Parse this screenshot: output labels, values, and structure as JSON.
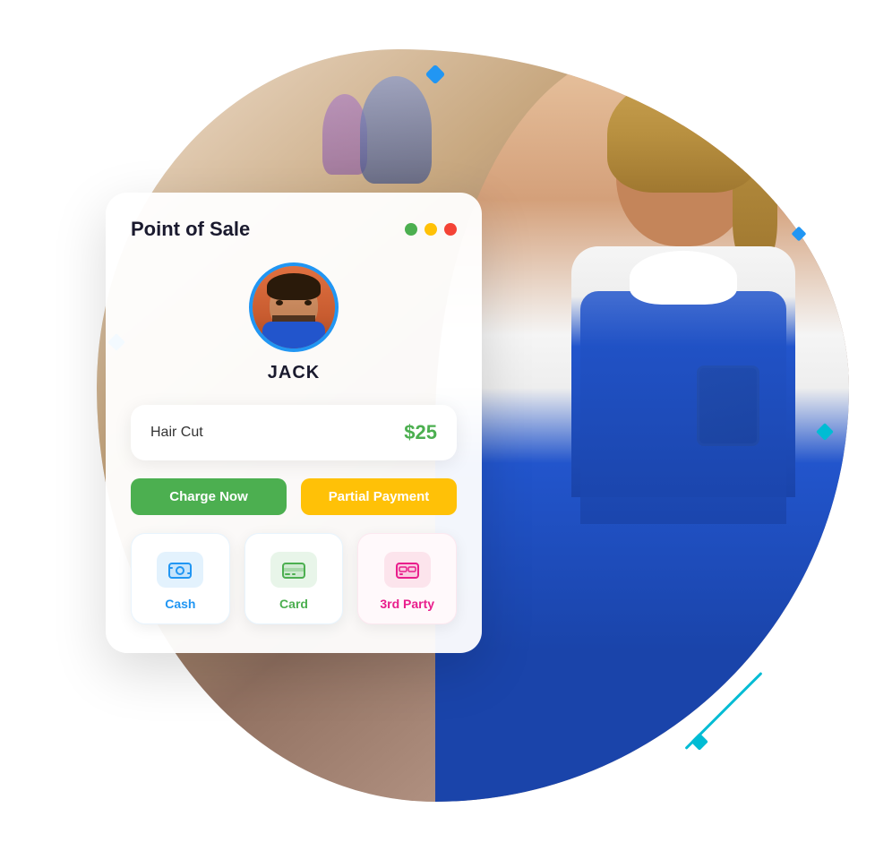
{
  "app": {
    "title": "Point of Sale"
  },
  "window_controls": {
    "green": "green-dot",
    "yellow": "yellow-dot",
    "red": "red-dot"
  },
  "customer": {
    "name": "JACK"
  },
  "service": {
    "name": "Hair Cut",
    "price": "$25"
  },
  "buttons": {
    "charge_now": "Charge Now",
    "partial_payment": "Partial Payment"
  },
  "payment_methods": [
    {
      "id": "cash",
      "label": "Cash",
      "type": "cash"
    },
    {
      "id": "card",
      "label": "Card",
      "type": "card"
    },
    {
      "id": "third_party",
      "label": "3rd Party",
      "type": "third"
    }
  ],
  "decorative_dots": {
    "color": "#2196F3"
  }
}
